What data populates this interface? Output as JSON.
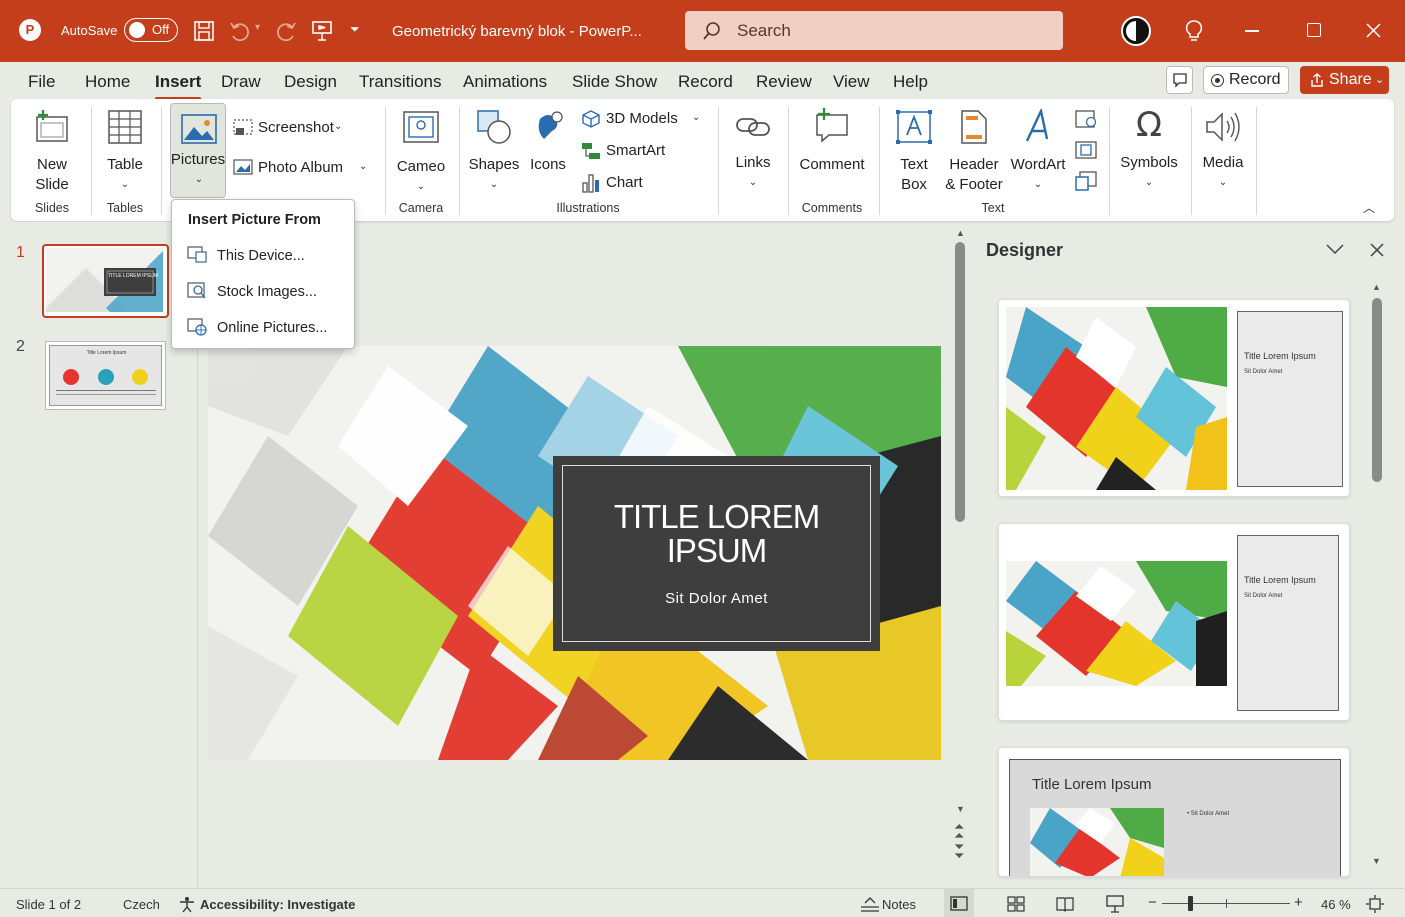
{
  "titlebar": {
    "autosave_label": "AutoSave",
    "autosave_state": "Off",
    "doc_title": "Geometrický barevný blok  -  PowerP...",
    "search_placeholder": "Search",
    "accent": "#c43e1c"
  },
  "menu": {
    "items": [
      "File",
      "Home",
      "Insert",
      "Draw",
      "Design",
      "Transitions",
      "Animations",
      "Slide Show",
      "Record",
      "Review",
      "View",
      "Help"
    ],
    "active": "Insert",
    "record_label": "Record",
    "share_label": "Share"
  },
  "ribbon": {
    "new_slide": "New\nSlide",
    "table": "Table",
    "pictures": "Pictures",
    "screenshot": "Screenshot",
    "photo_album": "Photo Album",
    "cameo": "Cameo",
    "shapes": "Shapes",
    "icons": "Icons",
    "models3d": "3D Models",
    "smartart": "SmartArt",
    "chart": "Chart",
    "links": "Links",
    "comment": "Comment",
    "textbox": "Text\nBox",
    "header_footer": "Header\n& Footer",
    "wordart": "WordArt",
    "symbols": "Symbols",
    "media": "Media",
    "groups": {
      "slides": "Slides",
      "tables": "Tables",
      "camera": "Camera",
      "illustrations": "Illustrations",
      "comments": "Comments",
      "text": "Text"
    }
  },
  "dropdown": {
    "header": "Insert Picture From",
    "items": [
      "This Device...",
      "Stock Images...",
      "Online Pictures..."
    ]
  },
  "thumbnails": {
    "numbers": [
      "1",
      "2"
    ],
    "slide1_title": "TITLE LOREM IPSUM",
    "slide2_title": "Title Lorem Ipsum"
  },
  "slide": {
    "title": "TITLE LOREM\nIPSUM",
    "subtitle": "Sit Dolor Amet"
  },
  "designer": {
    "title": "Designer",
    "card1_title": "Title Lorem Ipsum",
    "card1_sub": "Sit Dolor Amet",
    "card2_title": "Title Lorem Ipsum",
    "card2_sub": "Sit Dolor Amet",
    "card3_title": "Title Lorem Ipsum",
    "card3_sub": "• Sit Dolor Amet"
  },
  "status": {
    "slide_info": "Slide 1 of 2",
    "language": "Czech",
    "accessibility": "Accessibility: Investigate",
    "notes": "Notes",
    "zoom": "46 %"
  }
}
